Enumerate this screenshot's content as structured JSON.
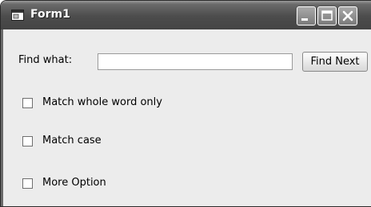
{
  "window": {
    "title": "Form1",
    "controls": {
      "minimize_icon": "minimize-icon",
      "maximize_icon": "maximize-icon",
      "close_icon": "close-icon"
    }
  },
  "find": {
    "label": "Find what:",
    "value": "",
    "placeholder": "",
    "button_label": "Find Next"
  },
  "options": [
    {
      "label": "Match whole word only",
      "checked": false
    },
    {
      "label": "Match case",
      "checked": false
    },
    {
      "label": "More Option",
      "checked": false
    }
  ],
  "colors": {
    "titlebar": "#4c4c4c",
    "window_bg": "#ececec",
    "title_text": "#ffffff"
  }
}
